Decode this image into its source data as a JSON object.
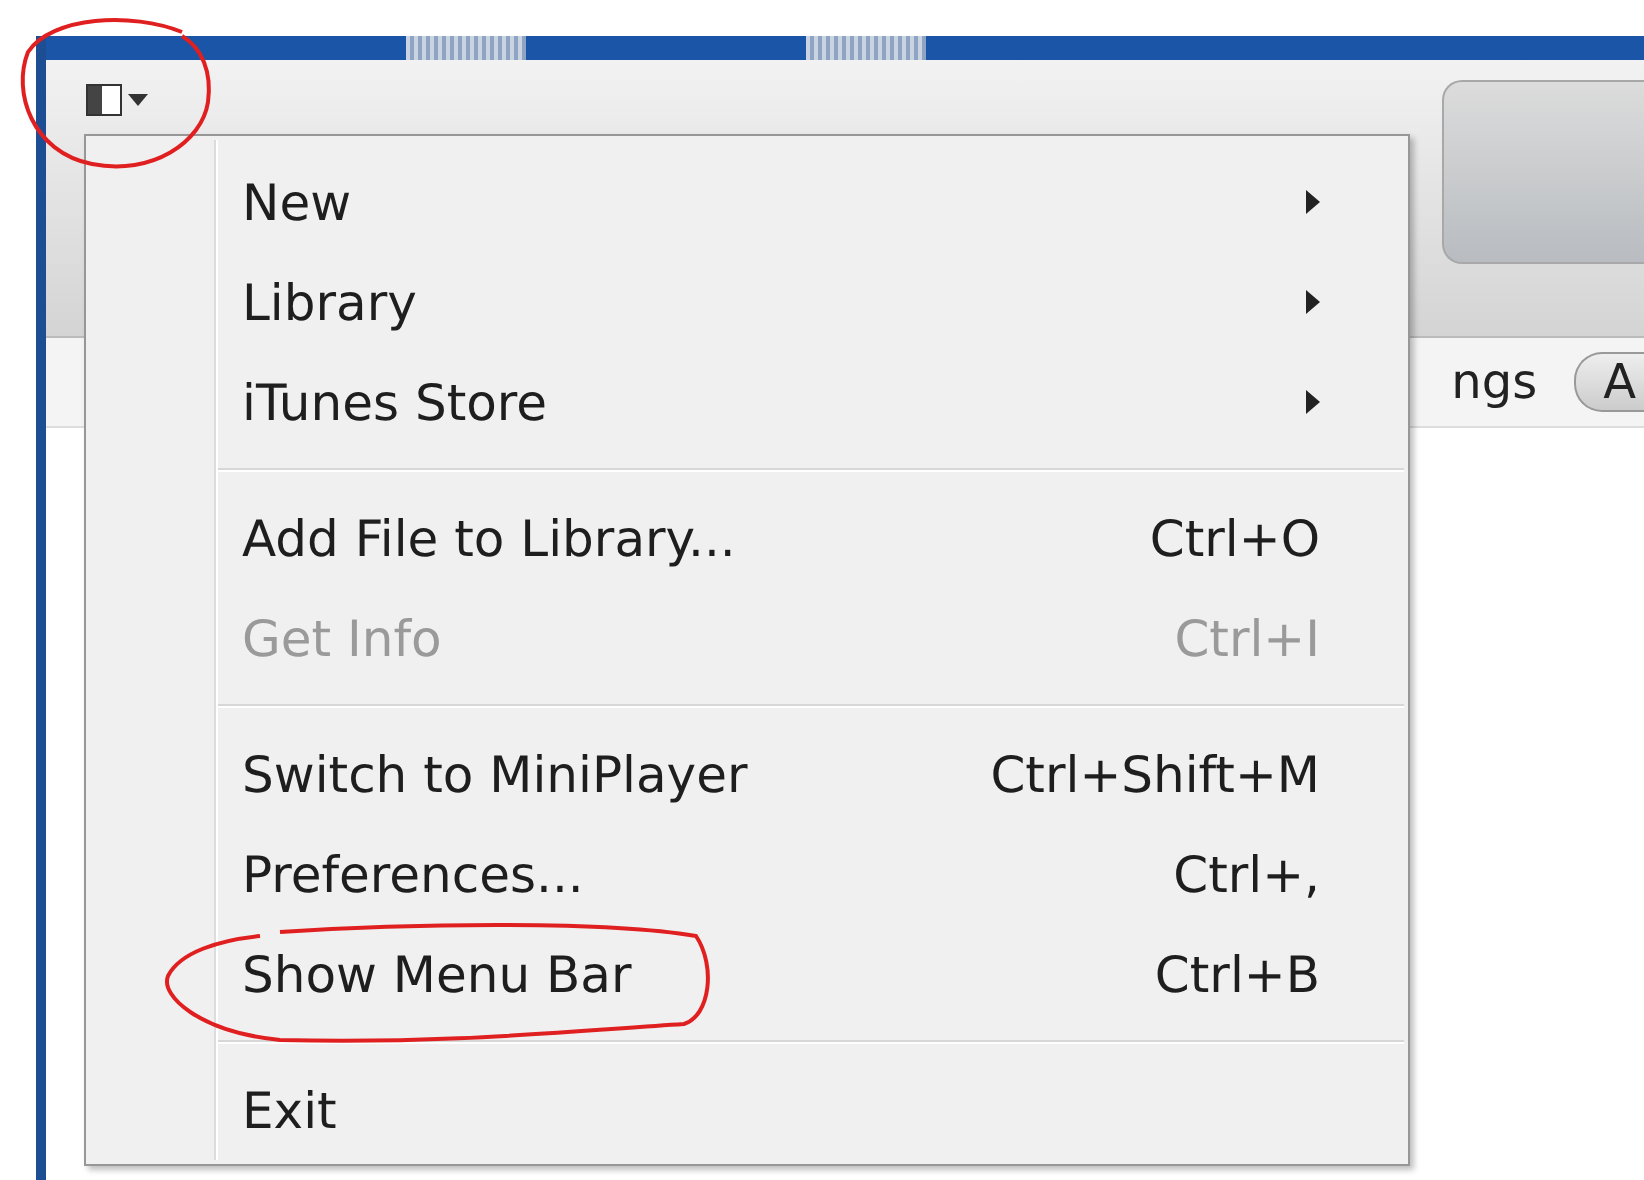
{
  "toolbar": {
    "behind_menu_texts": [
      "ngs",
      "A"
    ]
  },
  "menu": {
    "groups": [
      {
        "items": [
          {
            "kind": "submenu",
            "label": "New",
            "disabled": false
          },
          {
            "kind": "submenu",
            "label": "Library",
            "disabled": false
          },
          {
            "kind": "submenu",
            "label": "iTunes Store",
            "disabled": false
          }
        ]
      },
      {
        "items": [
          {
            "kind": "command",
            "label": "Add File to Library...",
            "shortcut": "Ctrl+O",
            "disabled": false
          },
          {
            "kind": "command",
            "label": "Get Info",
            "shortcut": "Ctrl+I",
            "disabled": true
          }
        ]
      },
      {
        "items": [
          {
            "kind": "command",
            "label": "Switch to MiniPlayer",
            "shortcut": "Ctrl+Shift+M",
            "disabled": false
          },
          {
            "kind": "command",
            "label": "Preferences...",
            "shortcut": "Ctrl+,",
            "disabled": false
          },
          {
            "kind": "command",
            "label": "Show Menu Bar",
            "shortcut": "Ctrl+B",
            "disabled": false
          }
        ]
      },
      {
        "items": [
          {
            "kind": "command",
            "label": "Exit",
            "disabled": false
          }
        ]
      }
    ]
  }
}
